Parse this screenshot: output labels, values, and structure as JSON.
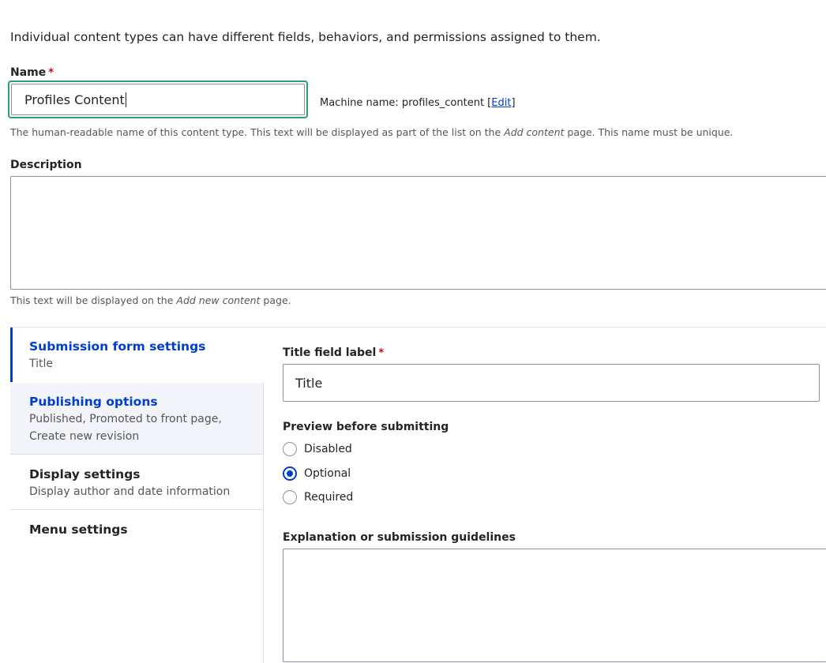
{
  "intro": "Individual content types can have different fields, behaviors, and permissions assigned to them.",
  "name_field": {
    "label": "Name",
    "required_mark": "*",
    "value": "Profiles Content",
    "machine_name_prefix": "Machine name: profiles_content [",
    "machine_name_link": "Edit",
    "machine_name_suffix": "]",
    "help_before": "The human-readable name of this content type. This text will be displayed as part of the list on the ",
    "help_em": "Add content",
    "help_after": " page. This name must be unique."
  },
  "description_field": {
    "label": "Description",
    "value": "",
    "help_before": "This text will be displayed on the ",
    "help_em": "Add new content",
    "help_after": " page."
  },
  "vertical_tabs": [
    {
      "title": "Submission form settings",
      "summary": "Title",
      "selected": true
    },
    {
      "title": "Publishing options",
      "summary": "Published, Promoted to front page, Create new revision",
      "selected": false
    },
    {
      "title": "Display settings",
      "summary": "Display author and date information",
      "selected": false
    },
    {
      "title": "Menu settings",
      "summary": "",
      "selected": false
    }
  ],
  "submission": {
    "title_label": "Title field label",
    "required_mark": "*",
    "title_value": "Title",
    "preview_label": "Preview before submitting",
    "preview_options": [
      {
        "label": "Disabled",
        "checked": false
      },
      {
        "label": "Optional",
        "checked": true
      },
      {
        "label": "Required",
        "checked": false
      }
    ],
    "explanation_label": "Explanation or submission guidelines",
    "explanation_value": ""
  },
  "colors": {
    "accent": "#003ecc",
    "focus_ring": "#2f9d6e",
    "required": "#c4071b",
    "tab_highlight_bg": "#f3f4f9"
  }
}
